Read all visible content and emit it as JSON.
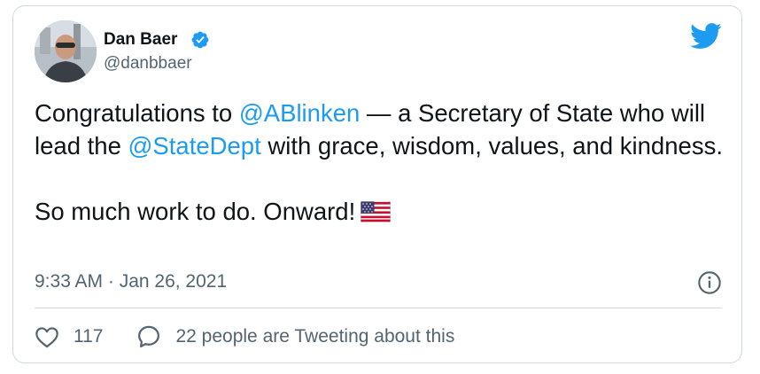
{
  "author": {
    "display_name": "Dan Baer",
    "handle": "@danbbaer",
    "verified": true
  },
  "tweet": {
    "segments_line1": {
      "part1": "Congratulations to ",
      "mention1": "@ABlinken",
      "part2": " — a Secretary of State who will lead the ",
      "mention2": "@StateDept",
      "part3": " with grace, wisdom, values, and kindness."
    },
    "line2": "So much work to do. Onward!",
    "emoji": "us-flag"
  },
  "timestamp": "9:33 AM · Jan 26, 2021",
  "actions": {
    "like_count": "117",
    "conversation_text": "22 people are Tweeting about this"
  },
  "icons": {
    "brand": "twitter-bird-icon",
    "verified": "verified-badge-icon",
    "info": "info-icon",
    "like": "heart-icon",
    "reply": "speech-bubble-icon"
  },
  "colors": {
    "link": "#1d9bf0",
    "text": "#0f1419",
    "secondary": "#536471",
    "border": "#cfd9de"
  }
}
